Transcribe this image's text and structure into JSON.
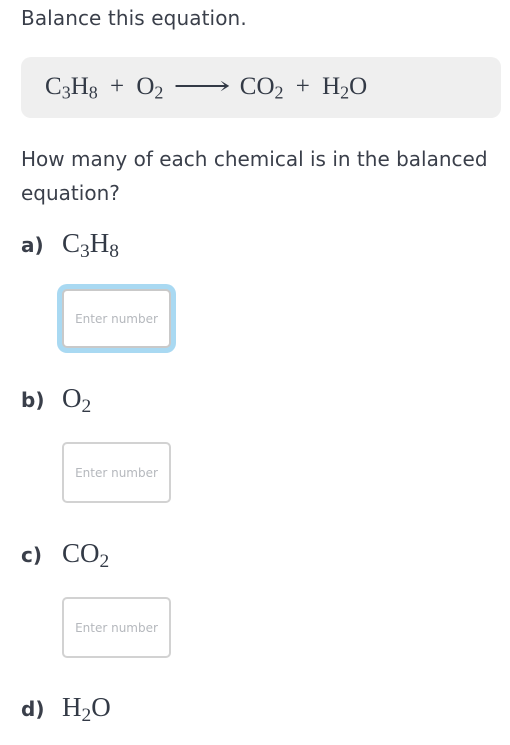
{
  "intro": "Balance this equation.",
  "equation": {
    "reactants": [
      {
        "base1": "C",
        "sub1": "3",
        "base2": "H",
        "sub2": "8"
      },
      {
        "base1": "O",
        "sub1": "2"
      }
    ],
    "products": [
      {
        "base1": "CO",
        "sub1": "2"
      },
      {
        "base1": "H",
        "sub1": "2",
        "base2": "O"
      }
    ],
    "plus": "+",
    "arrow": "⟶"
  },
  "question": "How many of each chemical is in the balanced equation?",
  "items": [
    {
      "letter": "a)",
      "base1": "C",
      "sub1": "3",
      "base2": "H",
      "sub2": "8",
      "placeholder": "Enter number",
      "value": "",
      "focused": true
    },
    {
      "letter": "b)",
      "base1": "O",
      "sub1": "2",
      "placeholder": "Enter number",
      "value": "",
      "focused": false
    },
    {
      "letter": "c)",
      "base1": "CO",
      "sub1": "2",
      "placeholder": "Enter number",
      "value": "",
      "focused": false
    },
    {
      "letter": "d)",
      "base1": "H",
      "sub1": "2",
      "base2": "O"
    }
  ],
  "colors": {
    "equation_box_bg": "#efefef",
    "focus_ring": "#a9d9f2",
    "input_border": "#d2d2d2",
    "text": "#3a3f4a"
  }
}
